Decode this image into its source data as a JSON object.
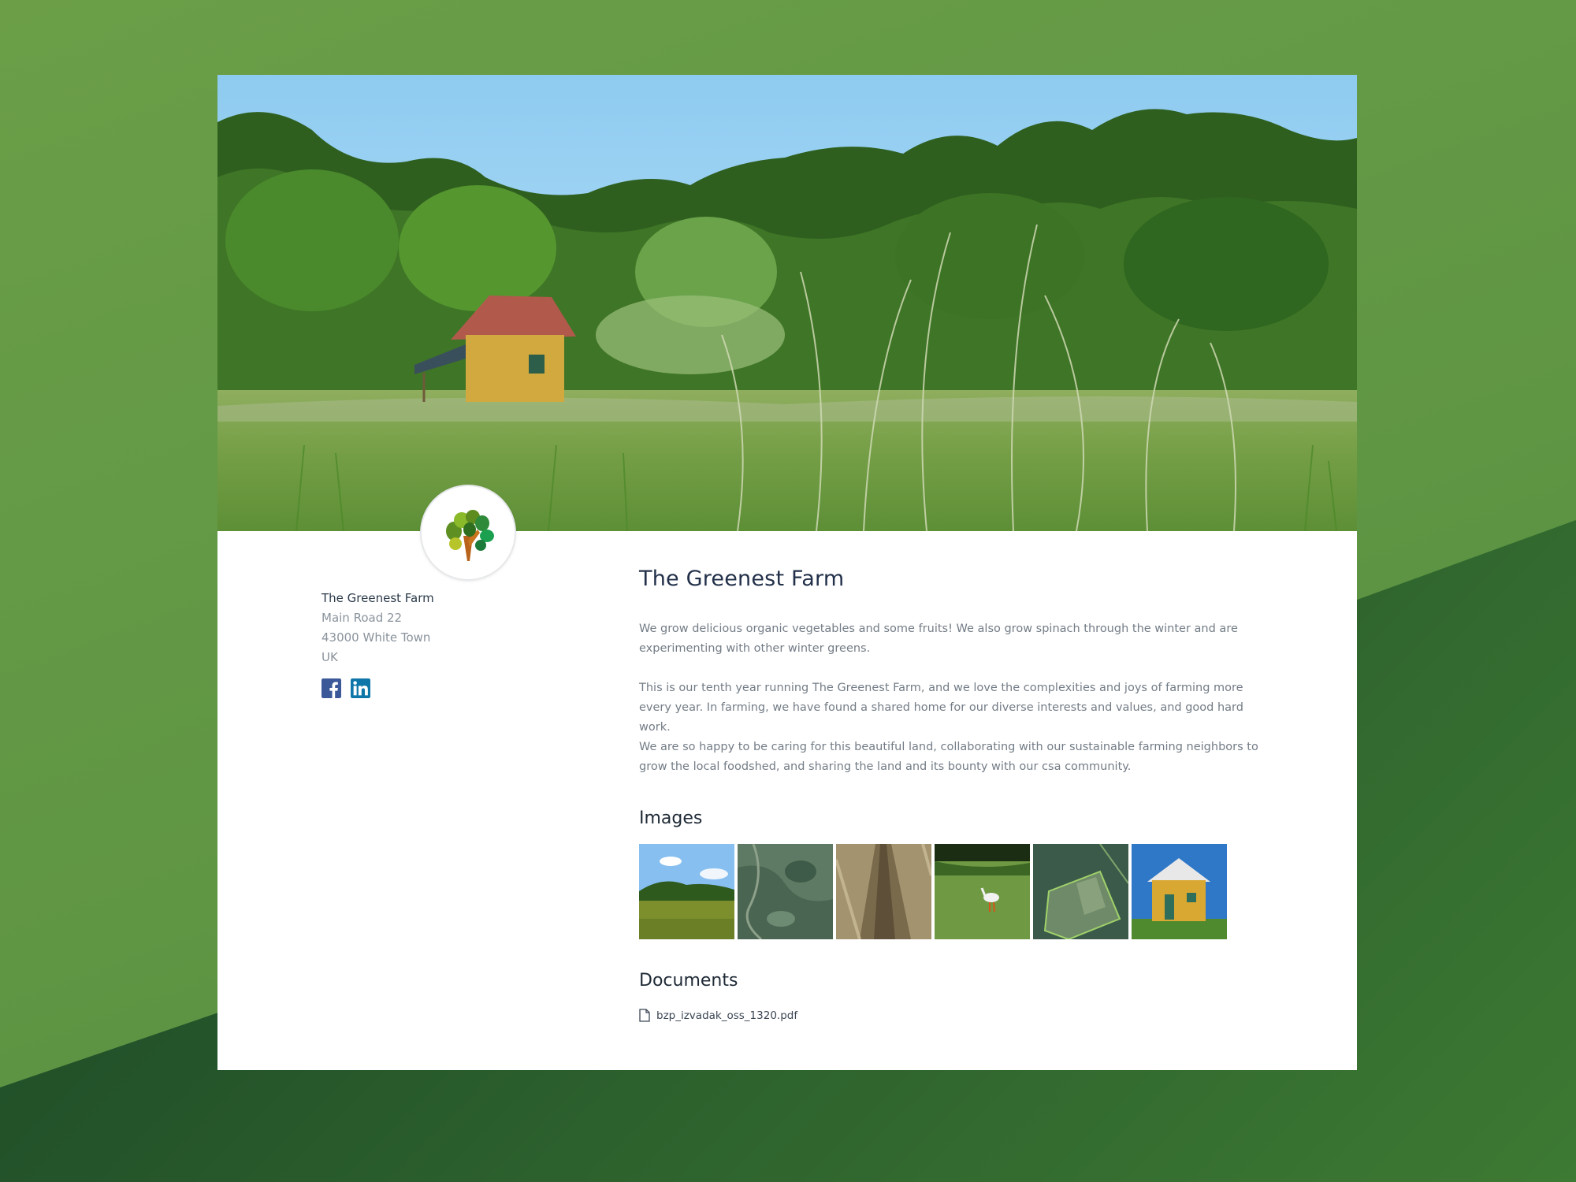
{
  "profile": {
    "name": "The Greenest Farm",
    "address": [
      "Main Road 22",
      "43000 White Town",
      "UK"
    ]
  },
  "social": [
    {
      "icon": "facebook-icon",
      "color": "#3b5998"
    },
    {
      "icon": "linkedin-icon",
      "color": "#0e76a8"
    }
  ],
  "main": {
    "title": "The Greenest Farm",
    "paragraphs": [
      "We grow delicious organic vegetables and some fruits! We also grow spinach through the winter and are experimenting with other winter greens.",
      "This is our tenth year running The Greenest Farm, and we love the complexities and joys of farming more every year. In farming, we have found a shared home for our diverse interests and values, and good hard work.",
      "We are so happy to be caring for this beautiful land, collaborating with our sustainable farming neighbors to grow the local foodshed, and sharing the land and its bounty with our csa community."
    ]
  },
  "images": {
    "title": "Images",
    "count": 6
  },
  "documents": {
    "title": "Documents",
    "files": [
      {
        "name": "bzp_izvadak_oss_1320.pdf",
        "icon": "file-icon"
      }
    ]
  },
  "colors": {
    "page_bg": "#66994a",
    "card_bg": "#ffffff",
    "title": "#22304a",
    "body_text": "#737c86"
  }
}
